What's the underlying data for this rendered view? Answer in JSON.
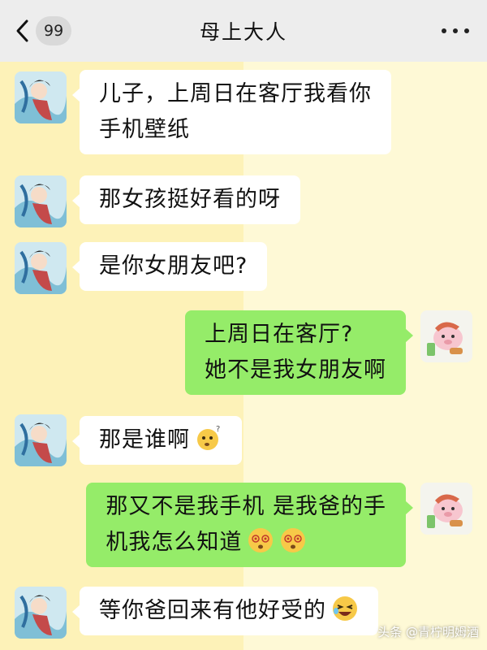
{
  "header": {
    "title": "母上大人",
    "unread_count": "99"
  },
  "messages": [
    {
      "side": "left",
      "lines": [
        "儿子，上周日在客厅我看你",
        "手机壁纸"
      ]
    },
    {
      "side": "left",
      "lines": [
        "那女孩挺好看的呀"
      ]
    },
    {
      "side": "left",
      "lines": [
        "是你女朋友吧?"
      ]
    },
    {
      "side": "right",
      "lines": [
        "上周日在客厅?",
        "她不是我女朋友啊"
      ]
    },
    {
      "side": "left",
      "lines": [
        "那是谁啊"
      ],
      "emoji": [
        "thinking-face"
      ]
    },
    {
      "side": "right",
      "lines": [
        "那又不是我手机 是我爸的手",
        "机我怎么知道"
      ],
      "emoji": [
        "dizzy-face",
        "dizzy-face"
      ]
    },
    {
      "side": "left",
      "lines": [
        "等你爸回来有他好受的"
      ],
      "emoji": [
        "laughing-face"
      ]
    }
  ],
  "watermark": "头条 @青柠明姆酒",
  "colors": {
    "header_bg": "#ededed",
    "right_bubble": "#95ec69",
    "left_bubble": "#ffffff",
    "bg_left": "#fdf2b8",
    "bg_right": "#fef9d6"
  }
}
